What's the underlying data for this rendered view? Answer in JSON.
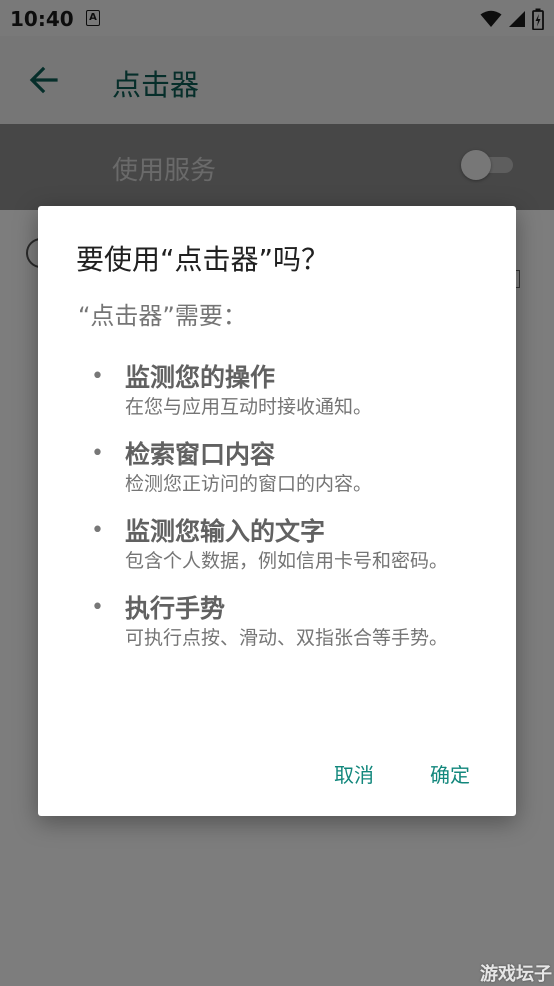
{
  "status_bar": {
    "time": "10:40",
    "notification_icon_letter": "A",
    "icons": [
      "wifi-icon",
      "signal-icon",
      "battery-icon"
    ]
  },
  "app_bar": {
    "back_icon": "arrow-left-icon",
    "title": "点击器"
  },
  "service_toggle": {
    "label": "使用服务",
    "enabled": false
  },
  "dialog": {
    "title": "要使用“点击器”吗？",
    "subtitle": "“点击器”需要：",
    "permissions": [
      {
        "title": "监测您的操作",
        "description": "在您与应用互动时接收通知。"
      },
      {
        "title": "检索窗口内容",
        "description": "检测您正访问的窗口的内容。"
      },
      {
        "title": "监测您输入的文字",
        "description": "包含个人数据，例如信用卡号和密码。"
      },
      {
        "title": "执行手势",
        "description": "可执行点按、滑动、双指张合等手势。"
      }
    ],
    "cancel_label": "取消",
    "confirm_label": "确定"
  },
  "watermark": "游戏坛子",
  "colors": {
    "accent": "#12877c",
    "app_title": "#0d5d55",
    "scrim": "#000000"
  }
}
